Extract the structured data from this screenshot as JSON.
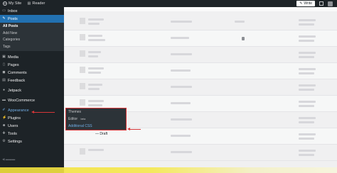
{
  "adminbar": {
    "my_site": "My Site",
    "reader": "Reader",
    "write_label": "Write"
  },
  "sidebar": {
    "items": [
      {
        "label": "Inbox",
        "icon": "inbox-icon"
      },
      {
        "label": "Posts",
        "icon": "pin-icon"
      },
      {
        "label": "Media",
        "icon": "media-icon"
      },
      {
        "label": "Pages",
        "icon": "pages-icon"
      },
      {
        "label": "Comments",
        "icon": "comment-icon"
      },
      {
        "label": "Feedback",
        "icon": "feedback-icon"
      },
      {
        "label": "Jetpack",
        "icon": "jetpack-icon"
      },
      {
        "label": "WooCommerce",
        "icon": "woo-icon"
      },
      {
        "label": "Appearance",
        "icon": "brush-icon"
      },
      {
        "label": "Plugins",
        "icon": "plug-icon"
      },
      {
        "label": "Users",
        "icon": "users-icon"
      },
      {
        "label": "Tools",
        "icon": "wrench-icon"
      },
      {
        "label": "Settings",
        "icon": "settings-icon"
      }
    ],
    "posts_submenu": [
      "All Posts",
      "Add New",
      "Categories",
      "Tags"
    ]
  },
  "flyout": {
    "items": [
      "Themes",
      "Editor",
      "Additional CSS"
    ],
    "editor_badge": "beta"
  },
  "main": {
    "draft_label": "— Draft"
  },
  "colors": {
    "adminbar_bg": "#1d2327",
    "current_item": "#2271b1",
    "highlight_link": "#72aee6",
    "annotation_red": "#d63638",
    "bottom_strip": "#f2e13a"
  }
}
